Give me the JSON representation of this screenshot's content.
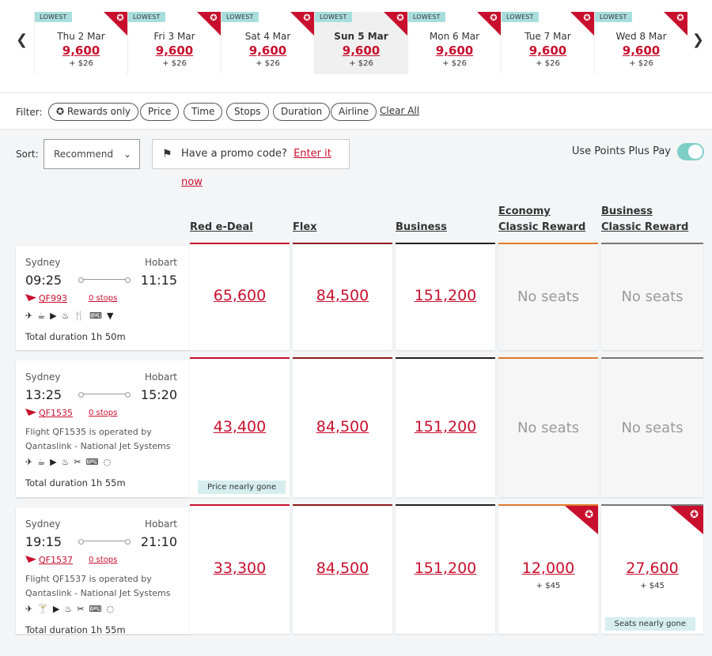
{
  "dates": [
    {
      "label": "Thu 2 Mar",
      "points": "9,600",
      "fee": "+ $26",
      "badge": "LOWEST",
      "active": false
    },
    {
      "label": "Fri 3 Mar",
      "points": "9,600",
      "fee": "+ $26",
      "badge": "LOWEST",
      "active": false
    },
    {
      "label": "Sat 4 Mar",
      "points": "9,600",
      "fee": "+ $26",
      "badge": "LOWEST",
      "active": false
    },
    {
      "label": "Sun 5 Mar",
      "points": "9,600",
      "fee": "+ $26",
      "badge": "LOWEST",
      "active": true
    },
    {
      "label": "Mon 6 Mar",
      "points": "9,600",
      "fee": "+ $26",
      "badge": "LOWEST",
      "active": false
    },
    {
      "label": "Tue 7 Mar",
      "points": "9,600",
      "fee": "+ $26",
      "badge": "LOWEST",
      "active": false
    },
    {
      "label": "Wed 8 Mar",
      "points": "9,600",
      "fee": "+ $26",
      "badge": "LOWEST",
      "active": false
    }
  ],
  "filter": {
    "label": "Filter:",
    "chips": [
      "Rewards only",
      "Price",
      "Time",
      "Stops",
      "Duration",
      "Airline"
    ],
    "clear": "Clear All"
  },
  "sort": {
    "label": "Sort:",
    "value": "Recommend"
  },
  "promo": {
    "text": "Have a promo code?",
    "link": "Enter it now"
  },
  "points_plus_pay": {
    "label": "Use Points Plus Pay",
    "enabled": true
  },
  "columns": [
    {
      "line1": "",
      "line2": "Red e-Deal"
    },
    {
      "line1": "",
      "line2": "Flex"
    },
    {
      "line1": "",
      "line2": "Business"
    },
    {
      "line1": "Economy",
      "line2": "Classic Reward"
    },
    {
      "line1": "Business",
      "line2": "Classic Reward"
    }
  ],
  "flights": [
    {
      "from": "Sydney",
      "to": "Hobart",
      "dep": "09:25",
      "arr": "11:15",
      "number": "QF993",
      "stops": "0 stops",
      "operated_by": "",
      "amenities": "✈☕▶♨🍴⌨▼",
      "duration": "Total duration 1h 50m",
      "fares": [
        {
          "points": "65,600",
          "fee": "",
          "note": ""
        },
        {
          "points": "84,500",
          "fee": "",
          "note": ""
        },
        {
          "points": "151,200",
          "fee": "",
          "note": ""
        },
        {
          "points": "",
          "fee": "",
          "note": "",
          "no_seats": "No seats"
        },
        {
          "points": "",
          "fee": "",
          "note": "",
          "no_seats": "No seats"
        }
      ]
    },
    {
      "from": "Sydney",
      "to": "Hobart",
      "dep": "13:25",
      "arr": "15:20",
      "number": "QF1535",
      "stops": "0 stops",
      "operated_by": "Flight QF1535 is operated by Qantaslink - National Jet Systems",
      "amenities": "✈☕▶♨✂⌨◌",
      "duration": "Total duration 1h 55m",
      "fares": [
        {
          "points": "43,400",
          "fee": "",
          "note": "Price nearly gone"
        },
        {
          "points": "84,500",
          "fee": "",
          "note": ""
        },
        {
          "points": "151,200",
          "fee": "",
          "note": ""
        },
        {
          "points": "",
          "fee": "",
          "note": "",
          "no_seats": "No seats"
        },
        {
          "points": "",
          "fee": "",
          "note": "",
          "no_seats": "No seats"
        }
      ]
    },
    {
      "from": "Sydney",
      "to": "Hobart",
      "dep": "19:15",
      "arr": "21:10",
      "number": "QF1537",
      "stops": "0 stops",
      "operated_by": "Flight QF1537 is operated by Qantaslink - National Jet Systems",
      "amenities": "✈🍸▶♨✂⌨◌",
      "duration": "Total duration 1h 55m",
      "fares": [
        {
          "points": "33,300",
          "fee": "",
          "note": ""
        },
        {
          "points": "84,500",
          "fee": "",
          "note": ""
        },
        {
          "points": "151,200",
          "fee": "",
          "note": ""
        },
        {
          "points": "12,000",
          "fee": "+ $45",
          "note": "",
          "reward": true
        },
        {
          "points": "27,600",
          "fee": "+ $45",
          "note": "Seats nearly gone",
          "reward": true
        }
      ]
    }
  ]
}
